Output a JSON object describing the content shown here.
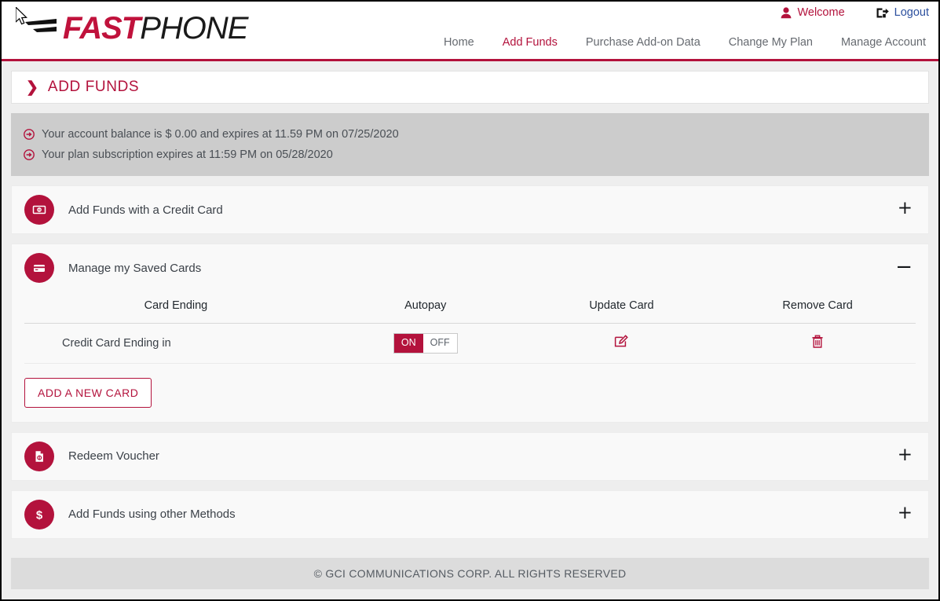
{
  "brand": {
    "logo_fast": "FAST",
    "logo_phone": "PHONE",
    "accent_color": "#b3123c",
    "link_color": "#2b4f9e"
  },
  "header": {
    "welcome_label": "Welcome",
    "logout_label": "Logout",
    "welcome_icon": "person-icon",
    "logout_icon": "sign-out-icon",
    "nav": [
      {
        "label": "Home",
        "active": false
      },
      {
        "label": "Add Funds",
        "active": true
      },
      {
        "label": "Purchase Add-on Data",
        "active": false
      },
      {
        "label": "Change My Plan",
        "active": false
      },
      {
        "label": "Manage Account",
        "active": false
      }
    ]
  },
  "page": {
    "title": "ADD FUNDS",
    "title_icon": "chevron-right-icon"
  },
  "alerts": {
    "icon": "arrow-circle-right-icon",
    "lines": [
      "Your account balance is $ 0.00 and expires at 11.59 PM on 07/25/2020",
      "Your plan subscription expires at 11:59 PM on 05/28/2020"
    ]
  },
  "accordions": [
    {
      "id": "add-funds-credit-card",
      "label": "Add Funds with a Credit Card",
      "icon": "banknote-icon",
      "expanded": false,
      "toggle": "+"
    },
    {
      "id": "manage-saved-cards",
      "label": "Manage my Saved Cards",
      "icon": "credit-card-icon",
      "expanded": true,
      "toggle": "−"
    },
    {
      "id": "redeem-voucher",
      "label": "Redeem Voucher",
      "icon": "voucher-document-icon",
      "expanded": false,
      "toggle": "+"
    },
    {
      "id": "add-funds-other-methods",
      "label": "Add Funds using other Methods",
      "icon": "dollar-sign-icon",
      "expanded": false,
      "toggle": "+"
    }
  ],
  "saved_cards": {
    "columns": [
      "Card Ending",
      "Autopay",
      "Update Card",
      "Remove Card"
    ],
    "rows": [
      {
        "card_ending": "Credit Card Ending in",
        "autopay_on_label": "ON",
        "autopay_off_label": "OFF",
        "autopay_state": "ON",
        "update_icon": "edit-pencil-icon",
        "remove_icon": "trash-icon"
      }
    ],
    "add_card_label": "ADD A NEW CARD"
  },
  "footer": {
    "copyright": "© GCI COMMUNICATIONS CORP. ALL RIGHTS RESERVED"
  }
}
